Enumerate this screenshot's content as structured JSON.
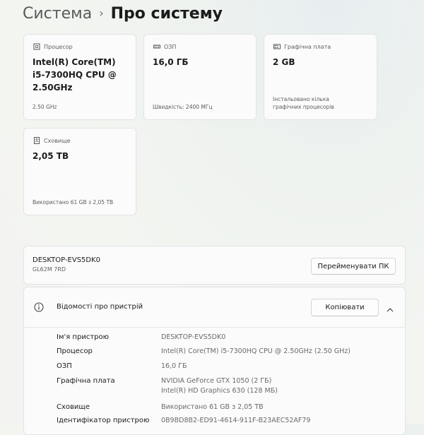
{
  "breadcrumb": {
    "parent": "Система",
    "separator": "›",
    "current": "Про систему"
  },
  "cards": {
    "processor": {
      "title": "Процесор",
      "value": "Intel(R) Core(TM) i5-7300HQ CPU @ 2.50GHz",
      "footer": "2.50 GHz"
    },
    "ram": {
      "title": "ОЗП",
      "value": "16,0 ГБ",
      "footer": "Швидкість: 2400 МГц"
    },
    "graphics": {
      "title": "Графічна плата",
      "value": "2 GB",
      "footer": "Інстальовано кілька графічних процесорів"
    },
    "storage": {
      "title": "Сховище",
      "value": "2,05 TB",
      "footer": "Використано 61 GB з 2,05 TB"
    }
  },
  "device": {
    "name": "DESKTOP-EVS5DK0",
    "model": "GL62M 7RD",
    "rename_label": "Перейменувати ПК"
  },
  "specs": {
    "title": "Відомості про пристрій",
    "copy_label": "Копіювати",
    "rows": [
      {
        "label": "Ім'я пристрою",
        "value": "DESKTOP-EVS5DK0"
      },
      {
        "label": "Процесор",
        "value": "Intel(R) Core(TM) i5-7300HQ CPU @ 2.50GHz (2.50 GHz)"
      },
      {
        "label": "ОЗП",
        "value": "16,0 ГБ"
      },
      {
        "label": "Графічна плата",
        "value": "NVIDIA GeForce GTX 1050 (2 ГБ)",
        "value2": "Intel(R) HD Graphics 630 (128 МБ)"
      },
      {
        "label": "Сховище",
        "value": "Використано 61 GB з 2,05 TB"
      },
      {
        "label": "Ідентифікатор пристрою",
        "value": "0B9BD8B2-ED91-4614-911F-B23AEC52AF79"
      }
    ]
  }
}
